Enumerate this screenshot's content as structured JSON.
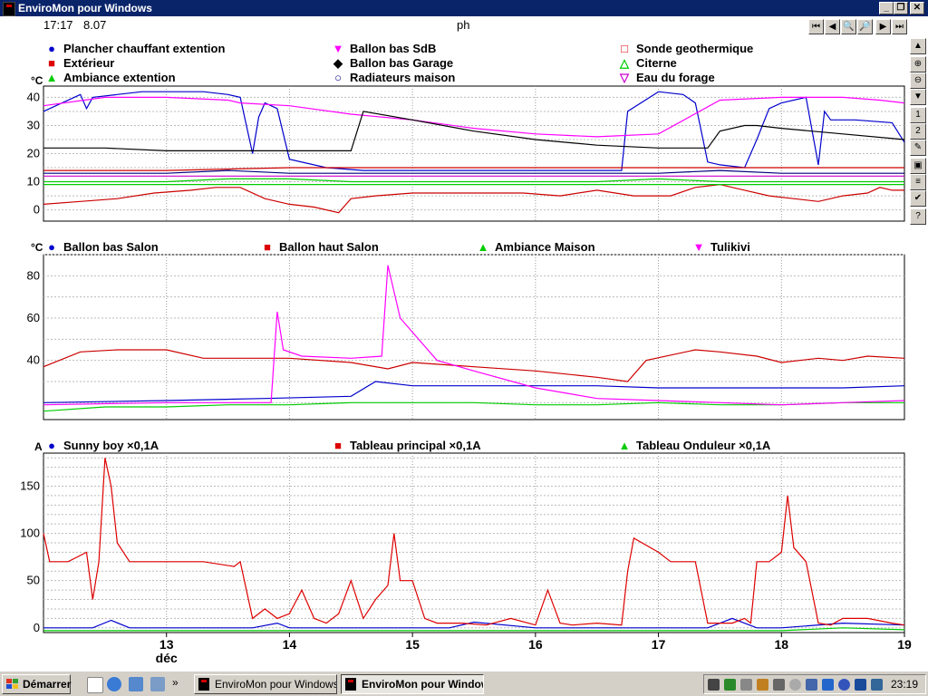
{
  "window": {
    "title": "EnviroMon pour Windows"
  },
  "header": {
    "time": "17:17",
    "value": "8.07",
    "center_label": "ph"
  },
  "panels": [
    {
      "unit": "°C",
      "legend": [
        {
          "label": "Plancher chauffant extention",
          "color": "#0000cc",
          "marker": "●"
        },
        {
          "label": "Extérieur",
          "color": "#dd0000",
          "marker": "■"
        },
        {
          "label": "Ambiance extention",
          "color": "#00cc00",
          "marker": "▲"
        },
        {
          "label": "Ballon bas SdB",
          "color": "#ff00ff",
          "marker": "▼"
        },
        {
          "label": "Ballon bas Garage",
          "color": "#000000",
          "marker": "◆"
        },
        {
          "label": "Radiateurs maison",
          "color": "#000080",
          "marker": "○"
        },
        {
          "label": "Sonde geothermique",
          "color": "#dd0000",
          "marker": "□"
        },
        {
          "label": "Citerne",
          "color": "#00cc00",
          "marker": "△"
        },
        {
          "label": "Eau du forage",
          "color": "#cc00cc",
          "marker": "▽"
        }
      ],
      "yticks": [
        "40",
        "30",
        "20",
        "10",
        "0"
      ]
    },
    {
      "unit": "°C",
      "legend": [
        {
          "label": "Ballon bas Salon",
          "color": "#0000cc",
          "marker": "●"
        },
        {
          "label": "Ballon haut Salon",
          "color": "#dd0000",
          "marker": "■"
        },
        {
          "label": "Ambiance Maison",
          "color": "#00cc00",
          "marker": "▲"
        },
        {
          "label": "Tulikivi",
          "color": "#ff00ff",
          "marker": "▼"
        }
      ],
      "yticks": [
        "80",
        "60",
        "40"
      ]
    },
    {
      "unit": "A",
      "legend": [
        {
          "label": "Sunny boy ×0,1A",
          "color": "#0000cc",
          "marker": "●"
        },
        {
          "label": "Tableau principal ×0,1A",
          "color": "#dd0000",
          "marker": "■"
        },
        {
          "label": "Tableau Onduleur ×0,1A",
          "color": "#00cc00",
          "marker": "▲"
        }
      ],
      "yticks": [
        "150",
        "100",
        "50",
        "0"
      ]
    }
  ],
  "xaxis": {
    "ticks": [
      "13",
      "14",
      "15",
      "16",
      "17",
      "18",
      "19"
    ],
    "month_label": "déc"
  },
  "chart_data": [
    {
      "type": "line",
      "ylim": [
        -4,
        44
      ],
      "x_range": [
        12.0,
        19.0
      ],
      "series": [
        {
          "name": "Plancher chauffant extention",
          "color": "#0000cc",
          "x": [
            12,
            12.3,
            12.35,
            12.4,
            12.8,
            13.0,
            13.3,
            13.5,
            13.6,
            13.7,
            13.75,
            13.8,
            13.9,
            14.0,
            14.3,
            14.6,
            15.0,
            15.5,
            16.0,
            16.5,
            16.7,
            16.75,
            17.0,
            17.2,
            17.3,
            17.4,
            17.5,
            17.7,
            17.8,
            17.9,
            18.0,
            18.2,
            18.3,
            18.35,
            18.4,
            18.6,
            18.9,
            19.0
          ],
          "y": [
            35,
            41,
            36,
            40,
            42,
            42,
            42,
            41,
            40,
            20,
            33,
            38,
            36,
            18,
            15,
            14,
            14,
            14,
            14,
            14,
            14,
            35,
            42,
            41,
            38,
            17,
            16,
            15,
            25,
            36,
            38,
            40,
            16,
            35,
            32,
            32,
            31,
            24
          ]
        },
        {
          "name": "Extérieur",
          "color": "#cc0000",
          "x": [
            12,
            12.3,
            12.6,
            12.9,
            13.2,
            13.4,
            13.6,
            13.8,
            14.0,
            14.2,
            14.4,
            14.5,
            14.7,
            15.0,
            15.3,
            15.6,
            15.9,
            16.2,
            16.5,
            16.8,
            17.1,
            17.3,
            17.5,
            17.7,
            17.9,
            18.1,
            18.3,
            18.5,
            18.7,
            18.8,
            18.9,
            19.0
          ],
          "y": [
            2,
            3,
            4,
            6,
            7,
            8,
            8,
            4,
            2,
            1,
            -1,
            4,
            5,
            6,
            6,
            6,
            6,
            5,
            7,
            5,
            5,
            8,
            9,
            7,
            5,
            4,
            3,
            5,
            6,
            8,
            7,
            7
          ]
        },
        {
          "name": "Ambiance extention",
          "color": "#00cc00",
          "x": [
            12,
            12.5,
            13,
            13.5,
            14,
            14.5,
            15,
            15.5,
            16,
            16.5,
            17,
            17.5,
            18,
            18.5,
            19
          ],
          "y": [
            10,
            10,
            10,
            11,
            11,
            10,
            10,
            10,
            10,
            10,
            11,
            10,
            10,
            10,
            10
          ]
        },
        {
          "name": "Ballon bas SdB",
          "color": "#ff00ff",
          "x": [
            12,
            12.5,
            13,
            13.5,
            13.6,
            14,
            14.5,
            15,
            15.5,
            16,
            16.5,
            17,
            17.5,
            18,
            18.5,
            18.8,
            19
          ],
          "y": [
            37,
            40,
            40,
            39,
            38,
            37,
            34,
            32,
            29,
            27,
            26,
            27,
            39,
            40,
            40,
            39,
            38
          ]
        },
        {
          "name": "Ballon bas Garage",
          "color": "#000000",
          "x": [
            12,
            12.5,
            13,
            13.5,
            14,
            14.5,
            14.6,
            15,
            15.5,
            16,
            16.5,
            17,
            17.4,
            17.5,
            17.7,
            17.8,
            18,
            18.5,
            19
          ],
          "y": [
            22,
            22,
            21,
            21,
            21,
            21,
            35,
            32,
            28,
            25,
            23,
            22,
            22,
            28,
            30,
            30,
            29,
            27,
            25
          ]
        },
        {
          "name": "Radiateurs maison",
          "color": "#000080",
          "x": [
            12,
            12.5,
            13,
            13.5,
            14,
            14.5,
            15,
            15.5,
            16,
            16.5,
            17,
            17.5,
            18,
            18.5,
            19
          ],
          "y": [
            13,
            13,
            13,
            14,
            13,
            13,
            13,
            13,
            13,
            13,
            13,
            14,
            13,
            13,
            13
          ]
        },
        {
          "name": "Sonde geothermique",
          "color": "#cc0000",
          "x": [
            12,
            13,
            14,
            15,
            16,
            17,
            18,
            19
          ],
          "y": [
            14,
            14,
            15,
            15,
            15,
            15,
            15,
            15
          ]
        },
        {
          "name": "Citerne",
          "color": "#00cc00",
          "x": [
            12,
            13,
            14,
            15,
            16,
            17,
            18,
            19
          ],
          "y": [
            9,
            9,
            9,
            9,
            9,
            9,
            9,
            9
          ]
        },
        {
          "name": "Eau du forage",
          "color": "#cc00cc",
          "x": [
            12,
            13,
            14,
            15,
            16,
            17,
            18,
            19
          ],
          "y": [
            12,
            12,
            12,
            12,
            12,
            12,
            12,
            12
          ]
        }
      ]
    },
    {
      "type": "line",
      "ylim": [
        12,
        90
      ],
      "x_range": [
        12.0,
        19.0
      ],
      "series": [
        {
          "name": "Ballon bas Salon",
          "color": "#0000cc",
          "x": [
            12,
            13,
            13.8,
            14.5,
            14.7,
            15.0,
            15.5,
            16,
            16.5,
            17,
            17.5,
            18,
            18.5,
            19
          ],
          "y": [
            20,
            21,
            22,
            23,
            30,
            28,
            28,
            28,
            28,
            27,
            27,
            27,
            27,
            28
          ]
        },
        {
          "name": "Ballon haut Salon",
          "color": "#cc0000",
          "x": [
            12,
            12.3,
            12.6,
            13.0,
            13.3,
            13.6,
            14.0,
            14.5,
            14.8,
            15.0,
            15.5,
            16.0,
            16.5,
            16.75,
            16.9,
            17.3,
            17.5,
            17.8,
            18.0,
            18.3,
            18.5,
            18.7,
            19
          ],
          "y": [
            37,
            44,
            45,
            45,
            41,
            41,
            41,
            39,
            36,
            39,
            37,
            35,
            32,
            30,
            40,
            45,
            44,
            42,
            39,
            41,
            40,
            42,
            41
          ]
        },
        {
          "name": "Ambiance Maison",
          "color": "#00cc00",
          "x": [
            12,
            12.5,
            13,
            13.5,
            14,
            14.5,
            15,
            15.5,
            16,
            16.5,
            17,
            17.5,
            18,
            18.5,
            19
          ],
          "y": [
            16,
            18,
            18,
            19,
            19,
            20,
            20,
            20,
            19,
            19,
            20,
            19,
            19,
            20,
            20
          ]
        },
        {
          "name": "Tulikivi",
          "color": "#ff00ff",
          "x": [
            12,
            13,
            13.85,
            13.9,
            13.95,
            14.1,
            14.5,
            14.75,
            14.8,
            14.9,
            15.2,
            15.5,
            16,
            16.5,
            17,
            17.5,
            18,
            18.5,
            19
          ],
          "y": [
            19,
            20,
            20,
            63,
            45,
            42,
            41,
            42,
            85,
            60,
            40,
            35,
            27,
            22,
            21,
            20,
            19,
            20,
            21
          ]
        }
      ]
    },
    {
      "type": "line",
      "ylim": [
        -5,
        185
      ],
      "x_range": [
        12.0,
        19.0
      ],
      "series": [
        {
          "name": "Sunny boy ×0,1A",
          "color": "#0000cc",
          "x": [
            12,
            12.4,
            12.55,
            12.7,
            13,
            13.7,
            13.9,
            14,
            14.5,
            15,
            15.3,
            15.5,
            16,
            16.5,
            17,
            17.4,
            17.6,
            17.8,
            18,
            18.5,
            19
          ],
          "y": [
            0,
            0,
            8,
            0,
            0,
            0,
            5,
            0,
            0,
            0,
            0,
            6,
            0,
            0,
            0,
            0,
            10,
            0,
            0,
            5,
            3
          ]
        },
        {
          "name": "Tableau principal ×0,1A",
          "color": "#dd0000",
          "x": [
            12,
            12.05,
            12.2,
            12.35,
            12.4,
            12.45,
            12.5,
            12.55,
            12.6,
            12.7,
            13.0,
            13.3,
            13.55,
            13.6,
            13.7,
            13.8,
            13.9,
            14.0,
            14.1,
            14.2,
            14.3,
            14.4,
            14.5,
            14.6,
            14.7,
            14.8,
            14.85,
            14.9,
            15.0,
            15.1,
            15.2,
            15.4,
            15.6,
            15.8,
            16.0,
            16.1,
            16.2,
            16.3,
            16.5,
            16.7,
            16.75,
            16.8,
            17.0,
            17.1,
            17.3,
            17.4,
            17.6,
            17.7,
            17.75,
            17.8,
            17.9,
            18.0,
            18.05,
            18.1,
            18.2,
            18.3,
            18.4,
            18.5,
            18.7,
            18.9,
            19.0
          ],
          "y": [
            100,
            70,
            70,
            80,
            30,
            70,
            180,
            150,
            90,
            70,
            70,
            70,
            65,
            70,
            10,
            20,
            10,
            15,
            40,
            10,
            5,
            15,
            50,
            10,
            30,
            45,
            100,
            50,
            50,
            10,
            5,
            5,
            3,
            10,
            3,
            40,
            5,
            3,
            5,
            3,
            60,
            95,
            80,
            70,
            70,
            5,
            5,
            10,
            5,
            70,
            70,
            80,
            140,
            85,
            70,
            5,
            3,
            10,
            10,
            5,
            3
          ]
        },
        {
          "name": "Tableau Onduleur ×0,1A",
          "color": "#00cc00",
          "x": [
            12,
            13,
            14,
            15,
            16,
            17,
            18,
            18.5,
            19
          ],
          "y": [
            -3,
            -3,
            -3,
            -3,
            -3,
            -3,
            -3,
            0,
            -2
          ]
        }
      ]
    }
  ]
}
